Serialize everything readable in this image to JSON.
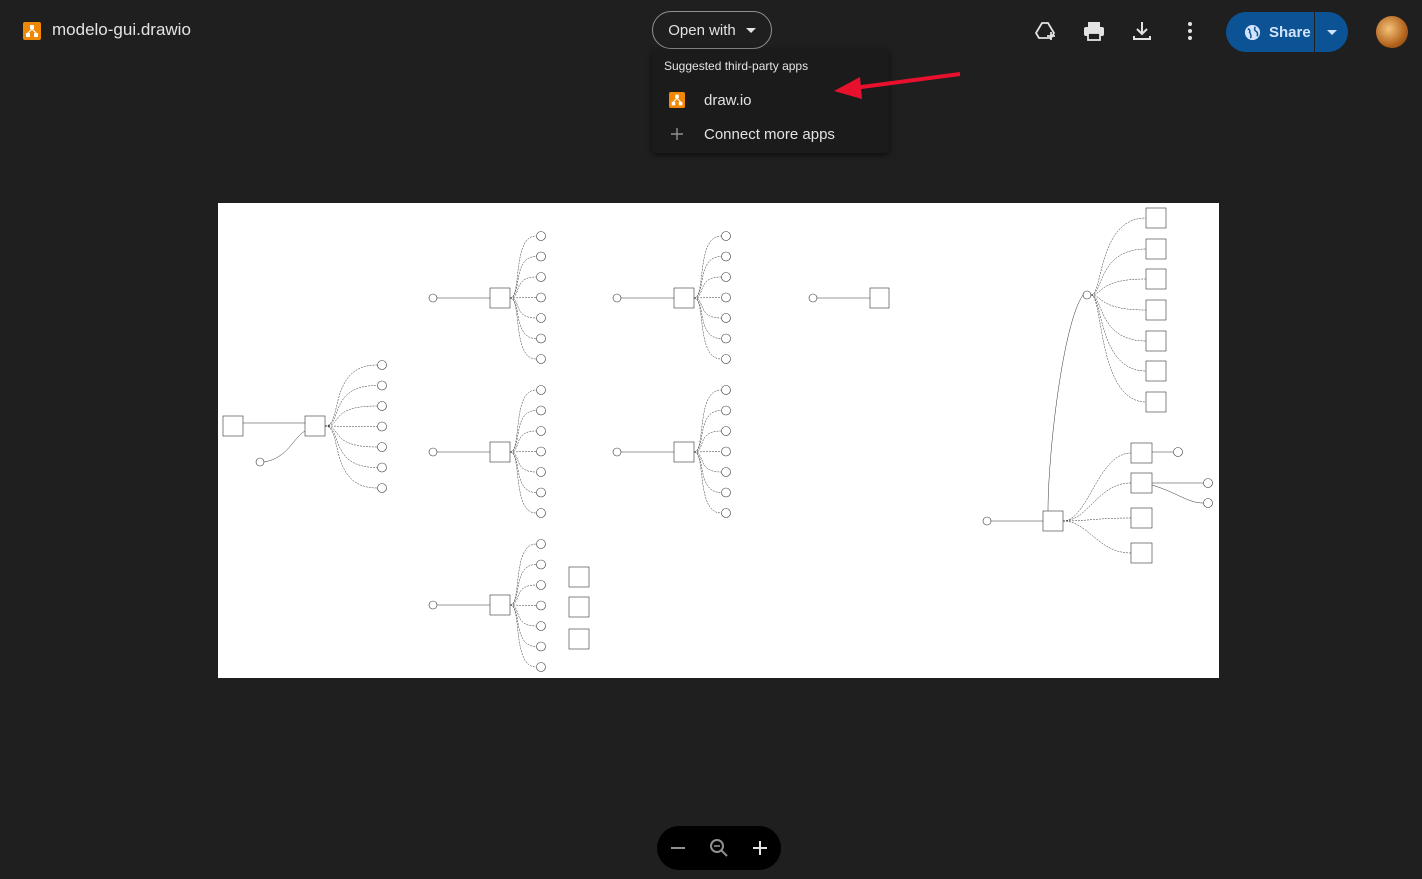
{
  "file": {
    "name": "modelo-gui.drawio",
    "icon": "drawio-icon"
  },
  "open_with": {
    "label": "Open with"
  },
  "toolbar": {
    "add_shortcut_icon": "add-to-drive-icon",
    "print_icon": "print-icon",
    "download_icon": "download-icon",
    "more_icon": "more-vert-icon"
  },
  "share": {
    "label": "Share"
  },
  "menu": {
    "header": "Suggested third-party apps",
    "items": [
      {
        "label": "draw.io",
        "icon": "drawio-icon"
      },
      {
        "label": "Connect more apps",
        "icon": "plus-icon"
      }
    ]
  },
  "colors": {
    "background": "#1f1f1f",
    "share_button": "#0b5394",
    "drawio_orange": "#f08705",
    "arrow": "#e8112d"
  }
}
